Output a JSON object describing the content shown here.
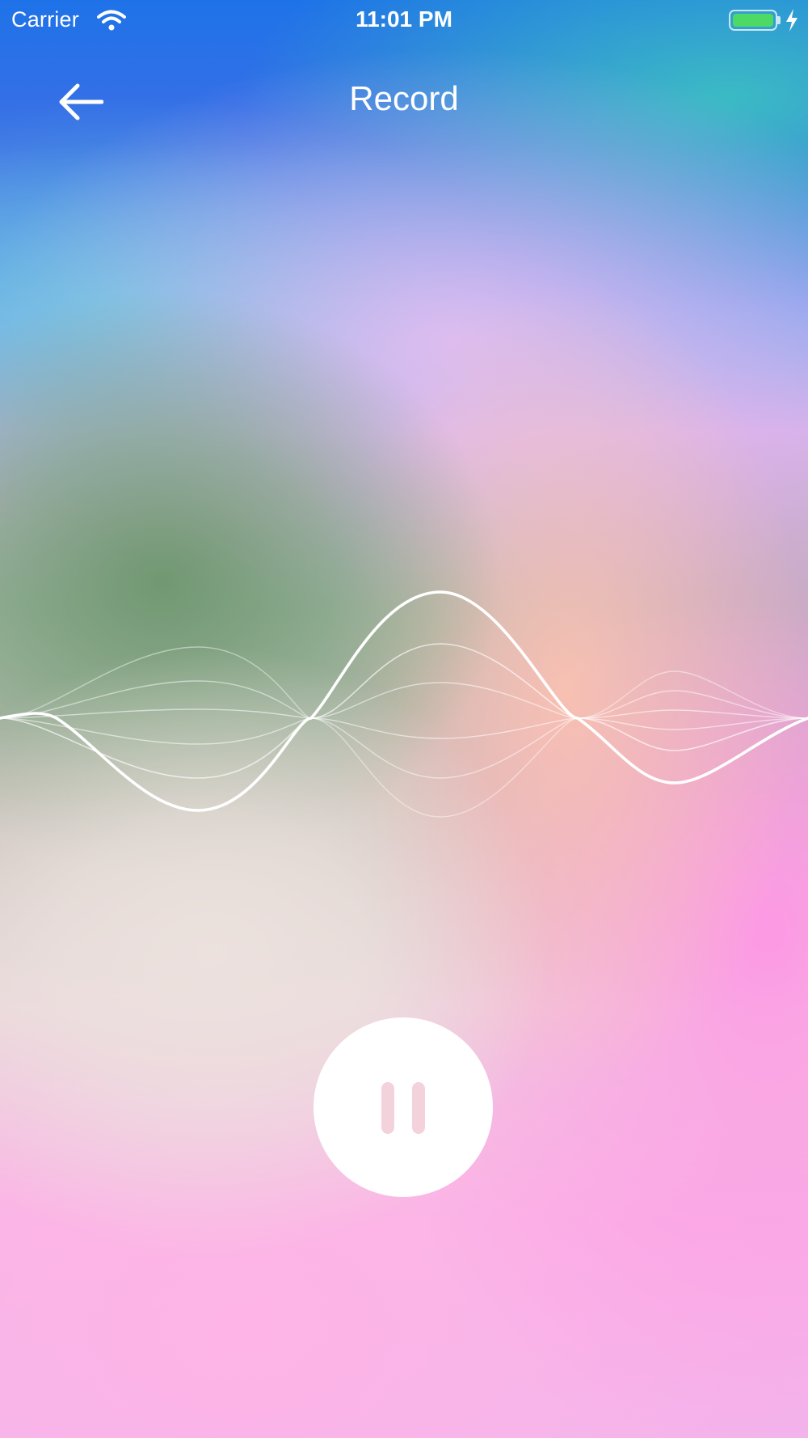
{
  "status_bar": {
    "carrier": "Carrier",
    "time": "11:01 PM",
    "wifi_icon": "wifi-icon",
    "battery_icon": "battery-icon",
    "charging_icon": "bolt-icon",
    "battery_color": "#4cd964"
  },
  "nav": {
    "title": "Record",
    "back_icon": "arrow-left-icon"
  },
  "recorder": {
    "waveform_icon": "sound-wave",
    "control_icon": "pause-icon",
    "control_color": "#ffffff",
    "pause_glyph_color": "#f3d2dc"
  }
}
